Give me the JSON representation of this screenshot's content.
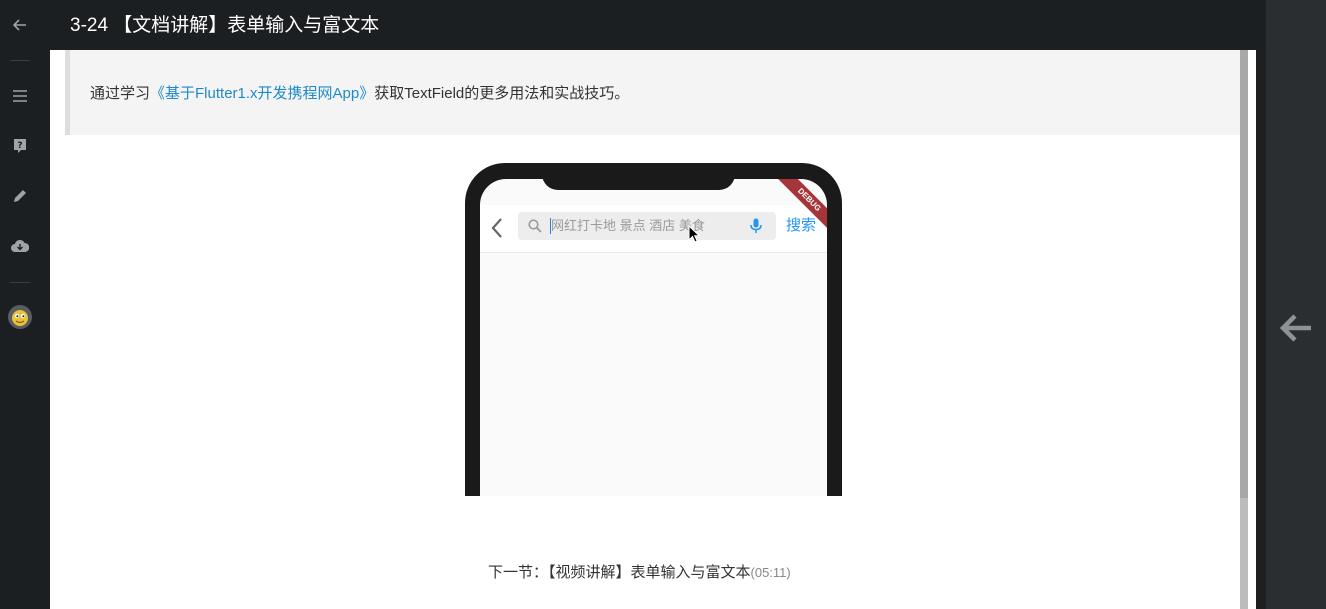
{
  "header": {
    "title": "3-24 【文档讲解】表单输入与富文本"
  },
  "sidebar": {
    "icons": [
      "back-arrow-icon",
      "menu-icon",
      "help-icon",
      "pencil-icon",
      "cloud-download-icon",
      "avatar"
    ]
  },
  "content": {
    "note": {
      "prefix": "通过学习",
      "link": "《基于Flutter1.x开发携程网App》",
      "suffix": "获取TextField的更多用法和实战技巧。"
    },
    "phone": {
      "search_placeholder": "网红打卡地 景点 酒店 美食",
      "search_button": "搜索",
      "debug_label": "DEBUG"
    },
    "next_section": {
      "label": "下一节：【视频讲解】表单输入与富文本",
      "duration": "(05:11)"
    }
  },
  "colors": {
    "link": "#1f8ac9",
    "accent_blue": "#2196f3",
    "dark_background": "#1c1f21"
  }
}
